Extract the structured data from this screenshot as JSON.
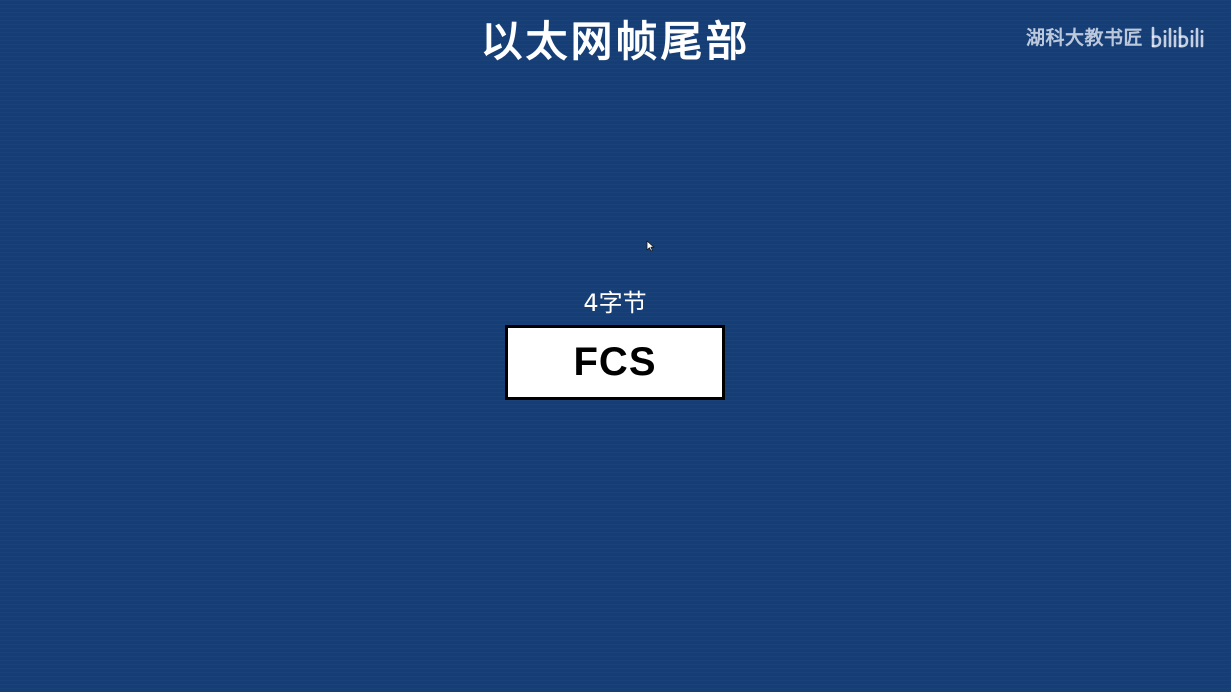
{
  "slide": {
    "title": "以太网帧尾部",
    "background_color": "#153e76"
  },
  "watermark": {
    "channel_name": "湖科大教书匠",
    "logo_text": "bilibili",
    "logo_icon": "bilibili-logo-icon"
  },
  "frame_trailer": {
    "field_size_label": "4字节",
    "field_name": "FCS"
  },
  "cursor": {
    "icon": "mouse-pointer-icon"
  }
}
